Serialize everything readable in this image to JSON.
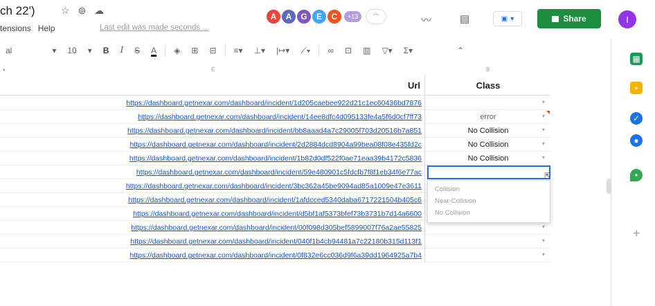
{
  "header": {
    "title": "ch 22')",
    "menu": [
      "tensions",
      "Help"
    ],
    "last_edit": "Last edit was made seconds ...",
    "avatars": [
      {
        "letter": "A",
        "color": "#e8453c"
      },
      {
        "letter": "A",
        "color": "#5c6bc0"
      },
      {
        "letter": "G",
        "color": "#7e57c2"
      },
      {
        "letter": "E",
        "color": "#42a5f5"
      },
      {
        "letter": "C",
        "color": "#f4511e"
      }
    ],
    "avatar_more": "+13",
    "share_label": "Share",
    "user_initial": "I",
    "icons": [
      "star-icon",
      "move-icon",
      "cloud-icon",
      "trend-icon",
      "comment-icon",
      "meet-icon"
    ]
  },
  "toolbar": {
    "font": "al",
    "font_size": "10",
    "bold": "B",
    "italic": "I",
    "strike": "S",
    "underline": "A"
  },
  "formula_bar": {
    "cell_ref": "•",
    "col_e": "E",
    "col_f": "B"
  },
  "table": {
    "headers": {
      "url": "Url",
      "class": "Class"
    },
    "rows": [
      {
        "url": "https://dashboard.getnexar.com/dashboard/incident/1d205caebee922d21c1ec60436bd7876",
        "class": ""
      },
      {
        "url": "https://dashboard.getnexar.com/dashboard/incident/14ee8dfc4d095133fe4a5f6d0cf7ff73",
        "class": "error"
      },
      {
        "url": "https://dashboard.getnexar.com/dashboard/incident/bb8aaad4a7c29005f703d20516b7a851",
        "class": "No Collision"
      },
      {
        "url": "https://dashboard.getnexar.com/dashboard/incident/2d2884dcd8904a99bea08f08e435fd2c",
        "class": "No Collision"
      },
      {
        "url": "https://dashboard.getnexar.com/dashboard/incident/1b82d0df522f0ae71eaa39b4172c5836",
        "class": "No Collision"
      },
      {
        "url": "https://dashboard.getnexar.com/dashboard/incident/59e480901c5fdcfb7f8f1eb34f6e77ac",
        "class": ""
      },
      {
        "url": "https://dashboard.getnexar.com/dashboard/incident/3bc362a45be9094ad85a1009e47e3611",
        "class": ""
      },
      {
        "url": "https://dashboard.getnexar.com/dashboard/incident/1afdcced5340daba6717221504b405c6",
        "class": ""
      },
      {
        "url": "https://dashboard.getnexar.com/dashboard/incident/d5bf1af5373bfef73b3731b7d14a6600",
        "class": ""
      },
      {
        "url": "https://dashboard.getnexar.com/dashboard/incident/00f098d305bef5899007f76a2ae55825",
        "class": ""
      },
      {
        "url": "https://dashboard.getnexar.com/dashboard/incident/040f1b4cb94481a7c22180b315d113f1",
        "class": ""
      },
      {
        "url": "https://dashboard.getnexar.com/dashboard/incident/0f832e6cc036d9f6a39dd1964925a7b4",
        "class": ""
      }
    ],
    "dropdown_options": [
      "Collision",
      "Near-Collision",
      "No Collision"
    ]
  },
  "side_panel": {
    "icons": [
      "sheets-icon",
      "keep-icon",
      "tasks-icon",
      "contacts-icon",
      "maps-icon",
      "add-icon"
    ],
    "colors": [
      "#0f9d58",
      "#f4b400",
      "#1a73e8",
      "#1a73e8",
      "#34a853"
    ]
  }
}
